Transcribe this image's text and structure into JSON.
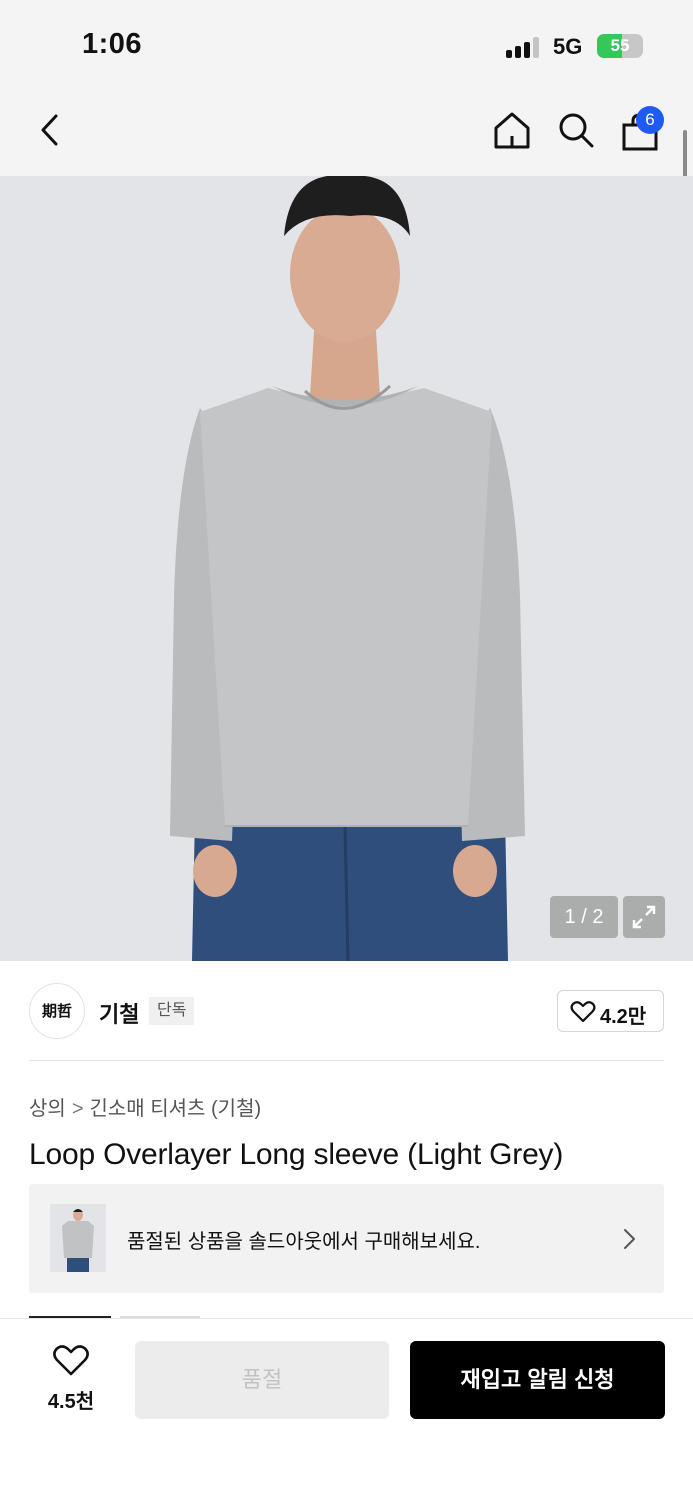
{
  "status_bar": {
    "time": "1:06",
    "network": "5G",
    "battery_percent": 55,
    "battery_label": "55",
    "battery_color": "#34c759",
    "signal_bars_active": 3,
    "signal_bars_total": 4
  },
  "nav": {
    "back_icon": "chevron-left-icon",
    "home_icon": "home-icon",
    "search_icon": "search-icon",
    "cart_icon": "shopping-bag-icon",
    "cart_count": "6",
    "badge_color": "#1f5af5"
  },
  "gallery": {
    "counter": "1 / 2",
    "current": 1,
    "total": 2,
    "expand_icon": "expand-icon"
  },
  "brand": {
    "logo_text": "期哲",
    "name": "기철",
    "tag": "단독",
    "like_icon": "heart-outline-icon",
    "like_count": "4.2만"
  },
  "breadcrumb": {
    "category": "상의",
    "separator": ">",
    "subcategory": "긴소매 티셔츠 (기철)"
  },
  "product": {
    "title": "Loop Overlayer Long sleeve (Light Grey)"
  },
  "soldout_banner": {
    "text": "품절된 상품을 솔드아웃에서 구매해보세요.",
    "chevron_icon": "chevron-right-icon"
  },
  "bottom_bar": {
    "wish_icon": "heart-outline-icon",
    "wish_count": "4.5천",
    "soldout_label": "품절",
    "restock_label": "재입고 알림 신청"
  },
  "colors": {
    "primary_button": "#000000",
    "disabled_button": "#ececec",
    "accent": "#1f5af5"
  }
}
